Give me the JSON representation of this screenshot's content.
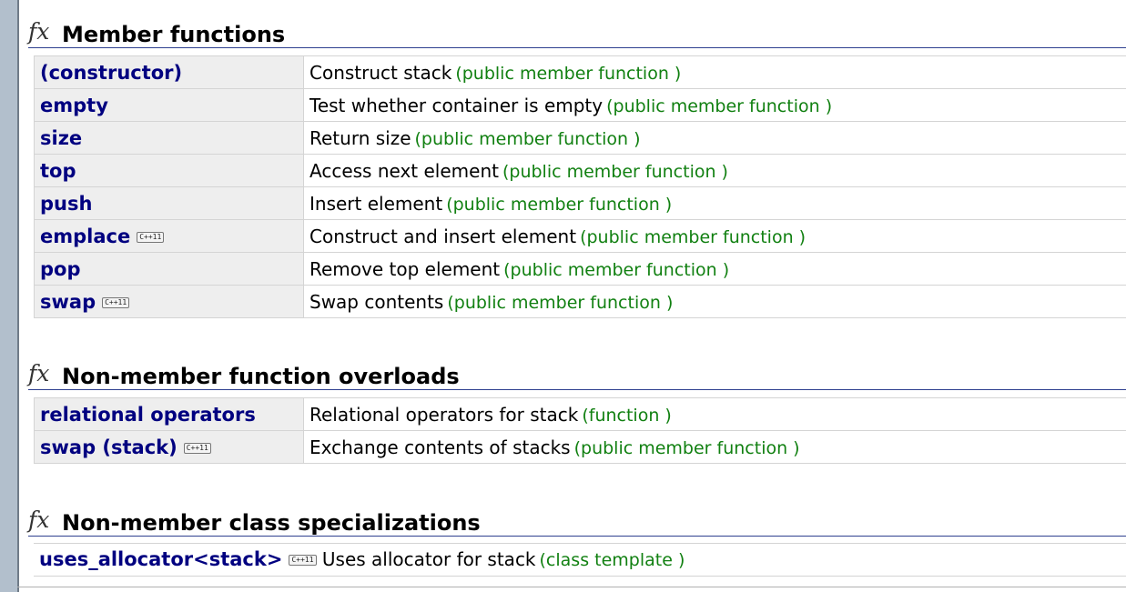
{
  "sections": [
    {
      "icon": "fx-icon",
      "title": "Member functions",
      "rows": [
        {
          "name": "(constructor)",
          "cpp11": "",
          "desc": "Construct stack",
          "kind": "(public member function )"
        },
        {
          "name": "empty",
          "cpp11": "",
          "desc": "Test whether container is empty",
          "kind": "(public member function )"
        },
        {
          "name": "size",
          "cpp11": "",
          "desc": "Return size",
          "kind": "(public member function )"
        },
        {
          "name": "top",
          "cpp11": "",
          "desc": "Access next element",
          "kind": "(public member function )"
        },
        {
          "name": "push",
          "cpp11": "",
          "desc": "Insert element",
          "kind": "(public member function )"
        },
        {
          "name": "emplace",
          "cpp11": "C++11",
          "desc": "Construct and insert element",
          "kind": "(public member function )"
        },
        {
          "name": "pop",
          "cpp11": "",
          "desc": "Remove top element",
          "kind": "(public member function )"
        },
        {
          "name": "swap",
          "cpp11": "C++11",
          "desc": "Swap contents",
          "kind": "(public member function )"
        }
      ]
    },
    {
      "icon": "fx-icon",
      "title": "Non-member function overloads",
      "rows": [
        {
          "name": "relational operators",
          "cpp11": "",
          "desc": "Relational operators for stack",
          "kind": "(function )"
        },
        {
          "name": "swap (stack)",
          "cpp11": "C++11",
          "desc": "Exchange contents of stacks",
          "kind": "(public member function )"
        }
      ]
    },
    {
      "icon": "fx-icon",
      "title": "Non-member class specializations",
      "rows": [
        {
          "name": "uses_allocator<stack>",
          "cpp11": "C++11",
          "desc": "Uses allocator for stack",
          "kind": "(class template )"
        }
      ]
    }
  ],
  "colors": {
    "link": "#000080",
    "kind": "#118011",
    "name_cell_bg": "#eeeeee",
    "header_rule": "#2e3f8f"
  }
}
